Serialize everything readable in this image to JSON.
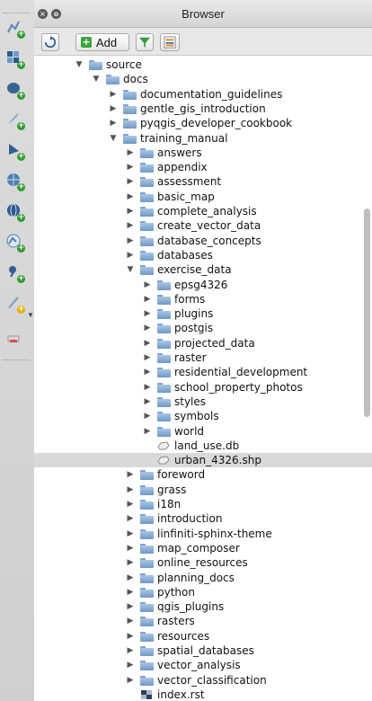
{
  "window": {
    "title": "Browser"
  },
  "toolbar": {
    "add_label": "Add"
  },
  "tree": [
    {
      "label": "source",
      "level": 0,
      "expanded": true,
      "type": "folder"
    },
    {
      "label": "docs",
      "level": 1,
      "expanded": true,
      "type": "folder"
    },
    {
      "label": "documentation_guidelines",
      "level": 2,
      "expanded": false,
      "type": "folder"
    },
    {
      "label": "gentle_gis_introduction",
      "level": 2,
      "expanded": false,
      "type": "folder"
    },
    {
      "label": "pyqgis_developer_cookbook",
      "level": 2,
      "expanded": false,
      "type": "folder"
    },
    {
      "label": "training_manual",
      "level": 2,
      "expanded": true,
      "type": "folder"
    },
    {
      "label": "answers",
      "level": 3,
      "expanded": false,
      "type": "folder"
    },
    {
      "label": "appendix",
      "level": 3,
      "expanded": false,
      "type": "folder"
    },
    {
      "label": "assessment",
      "level": 3,
      "expanded": false,
      "type": "folder"
    },
    {
      "label": "basic_map",
      "level": 3,
      "expanded": false,
      "type": "folder"
    },
    {
      "label": "complete_analysis",
      "level": 3,
      "expanded": false,
      "type": "folder"
    },
    {
      "label": "create_vector_data",
      "level": 3,
      "expanded": false,
      "type": "folder"
    },
    {
      "label": "database_concepts",
      "level": 3,
      "expanded": false,
      "type": "folder"
    },
    {
      "label": "databases",
      "level": 3,
      "expanded": false,
      "type": "folder"
    },
    {
      "label": "exercise_data",
      "level": 3,
      "expanded": true,
      "type": "folder"
    },
    {
      "label": "epsg4326",
      "level": 4,
      "expanded": false,
      "type": "folder"
    },
    {
      "label": "forms",
      "level": 4,
      "expanded": false,
      "type": "folder"
    },
    {
      "label": "plugins",
      "level": 4,
      "expanded": false,
      "type": "folder"
    },
    {
      "label": "postgis",
      "level": 4,
      "expanded": false,
      "type": "folder"
    },
    {
      "label": "projected_data",
      "level": 4,
      "expanded": false,
      "type": "folder"
    },
    {
      "label": "raster",
      "level": 4,
      "expanded": false,
      "type": "folder"
    },
    {
      "label": "residential_development",
      "level": 4,
      "expanded": false,
      "type": "folder"
    },
    {
      "label": "school_property_photos",
      "level": 4,
      "expanded": false,
      "type": "folder"
    },
    {
      "label": "styles",
      "level": 4,
      "expanded": false,
      "type": "folder"
    },
    {
      "label": "symbols",
      "level": 4,
      "expanded": false,
      "type": "folder"
    },
    {
      "label": "world",
      "level": 4,
      "expanded": false,
      "type": "folder"
    },
    {
      "label": "land_use.db",
      "level": 4,
      "type": "layer"
    },
    {
      "label": "urban_4326.shp",
      "level": 4,
      "type": "layer",
      "selected": true
    },
    {
      "label": "foreword",
      "level": 3,
      "expanded": false,
      "type": "folder"
    },
    {
      "label": "grass",
      "level": 3,
      "expanded": false,
      "type": "folder"
    },
    {
      "label": "i18n",
      "level": 3,
      "expanded": false,
      "type": "folder"
    },
    {
      "label": "introduction",
      "level": 3,
      "expanded": false,
      "type": "folder"
    },
    {
      "label": "linfiniti-sphinx-theme",
      "level": 3,
      "expanded": false,
      "type": "folder"
    },
    {
      "label": "map_composer",
      "level": 3,
      "expanded": false,
      "type": "folder"
    },
    {
      "label": "online_resources",
      "level": 3,
      "expanded": false,
      "type": "folder"
    },
    {
      "label": "planning_docs",
      "level": 3,
      "expanded": false,
      "type": "folder"
    },
    {
      "label": "python",
      "level": 3,
      "expanded": false,
      "type": "folder"
    },
    {
      "label": "qgis_plugins",
      "level": 3,
      "expanded": false,
      "type": "folder"
    },
    {
      "label": "rasters",
      "level": 3,
      "expanded": false,
      "type": "folder"
    },
    {
      "label": "resources",
      "level": 3,
      "expanded": false,
      "type": "folder"
    },
    {
      "label": "spatial_databases",
      "level": 3,
      "expanded": false,
      "type": "folder"
    },
    {
      "label": "vector_analysis",
      "level": 3,
      "expanded": false,
      "type": "folder"
    },
    {
      "label": "vector_classification",
      "level": 3,
      "expanded": false,
      "type": "folder"
    },
    {
      "label": "index.rst",
      "level": 3,
      "type": "file"
    }
  ]
}
